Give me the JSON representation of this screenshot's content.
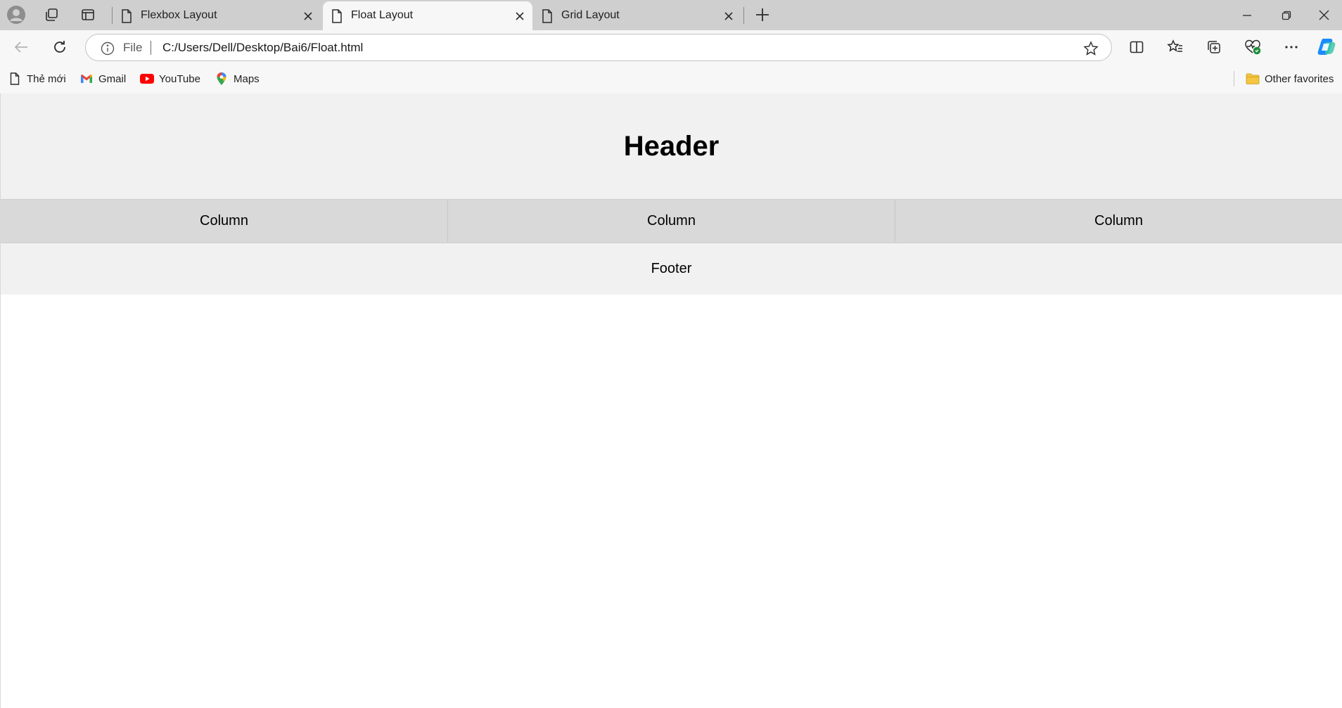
{
  "tabs": [
    {
      "title": "Flexbox Layout",
      "active": false
    },
    {
      "title": "Float Layout",
      "active": true
    },
    {
      "title": "Grid Layout",
      "active": false
    }
  ],
  "address_bar": {
    "scheme_label": "File",
    "url": "C:/Users/Dell/Desktop/Bai6/Float.html"
  },
  "favorites": [
    {
      "label": "Thẻ mới",
      "icon": "page-icon"
    },
    {
      "label": "Gmail",
      "icon": "gmail-icon"
    },
    {
      "label": "YouTube",
      "icon": "youtube-icon"
    },
    {
      "label": "Maps",
      "icon": "maps-icon"
    }
  ],
  "other_favorites": {
    "label": "Other favorites",
    "icon": "folder-icon"
  },
  "page": {
    "header": "Header",
    "columns": [
      "Column",
      "Column",
      "Column"
    ],
    "footer": "Footer"
  },
  "colors": {
    "tabstrip": "#cfcfcf",
    "toolbar": "#f7f7f7",
    "page_header_bg": "#f1f1f1",
    "page_columns_bg": "#d9d9d9",
    "page_footer_bg": "#f1f1f1",
    "copilot_accent": "#1a8cff"
  }
}
